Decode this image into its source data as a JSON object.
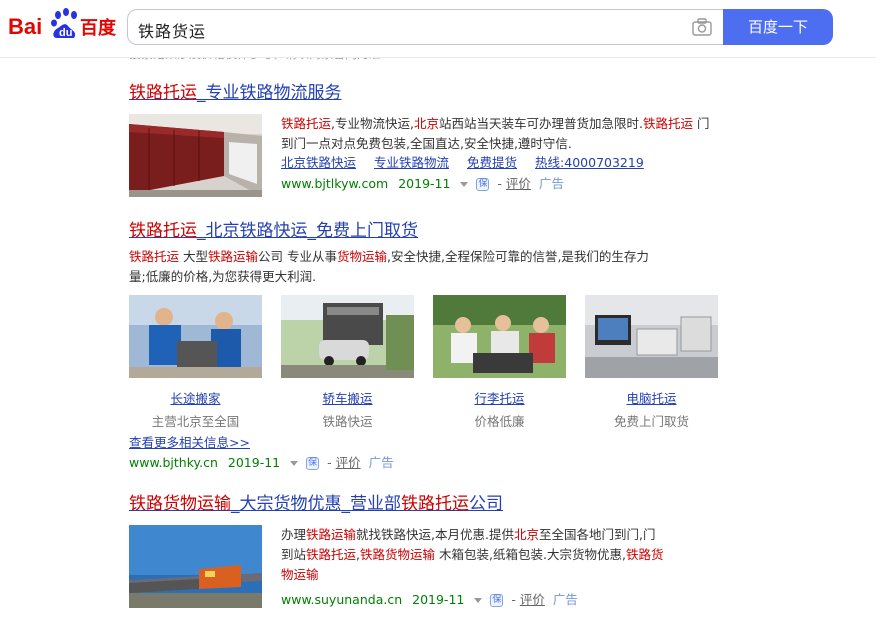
{
  "search": {
    "query": "铁路货运",
    "button_label": "百度一下",
    "hint": "搜索结果涉及价格仅作参考，请以商家官网为准"
  },
  "logo": {
    "text_bai": "Bai",
    "text_du": "du",
    "text_cn": "百度"
  },
  "results": [
    {
      "title_em": "铁路托运",
      "title_rest": "_专业铁路物流服务",
      "desc": [
        {
          "t": "铁路托运",
          "em": true
        },
        {
          "t": ",专业物流快运,",
          "em": false
        },
        {
          "t": "北京",
          "em": true
        },
        {
          "t": "站西站当天装车可办理普货加急限时.",
          "em": false
        },
        {
          "t": "铁路托运",
          "em": true
        },
        {
          "t": " 门到门一点对点免费包装,全国直达,安全快捷,遵时守信.",
          "em": false
        }
      ],
      "links": [
        "北京铁路快运",
        "专业铁路物流",
        "免费提货",
        "热线:4000703219"
      ],
      "url": "www.bjtlkyw.com",
      "date": "2019-11",
      "review": "评价",
      "ad": "广告"
    },
    {
      "title_parts": [
        "铁路托运",
        "_北京铁路快运_免费上门取货"
      ],
      "desc_1": "铁路托运",
      "desc_2": " 大型",
      "desc_3": "铁路运输",
      "desc_4": "公司 专业从事",
      "desc_5": "货物运输",
      "desc_6": ",安全快捷,全程保险可靠的信誉,是我们的生存力",
      "desc_7": "量;低廉的价格,为您获得更大利润.",
      "gallery": [
        {
          "caption": "长途搬家",
          "sub": "主营北京至全国"
        },
        {
          "caption": "轿车搬运",
          "sub": "铁路快运"
        },
        {
          "caption": "行李托运",
          "sub": "价格低廉"
        },
        {
          "caption": "电脑托运",
          "sub": "免费上门取货"
        }
      ],
      "more": "查看更多相关信息>>",
      "url": "www.bjthky.cn",
      "date": "2019-11",
      "review": "评价",
      "ad": "广告"
    },
    {
      "title_a": "铁路货物运输",
      "title_b": "_大宗货物优惠_营业部",
      "title_c": "铁路托运",
      "title_d": "公司",
      "desc_line1_a": "办理",
      "desc_line1_b": "铁路运输",
      "desc_line1_c": "就找铁路快运,本月优惠.提供",
      "desc_line1_d": "北京",
      "desc_line1_e": "至全国各地门到门,门",
      "desc_line2_a": "到站",
      "desc_line2_b": "铁路托运",
      "desc_line2_c": ",",
      "desc_line2_d": "铁路货物运输",
      "desc_line2_e": " 木箱包装,纸箱包装.大宗货物优惠,",
      "desc_line2_f": "铁路货",
      "desc_line3": "物运输",
      "url": "www.suyunanda.cn",
      "date": "2019-11",
      "review": "评价",
      "ad": "广告"
    }
  ],
  "colors": {
    "accent": "#4e6ef2",
    "link": "#2440b3",
    "highlight": "#c00000",
    "url_green": "#008000"
  }
}
